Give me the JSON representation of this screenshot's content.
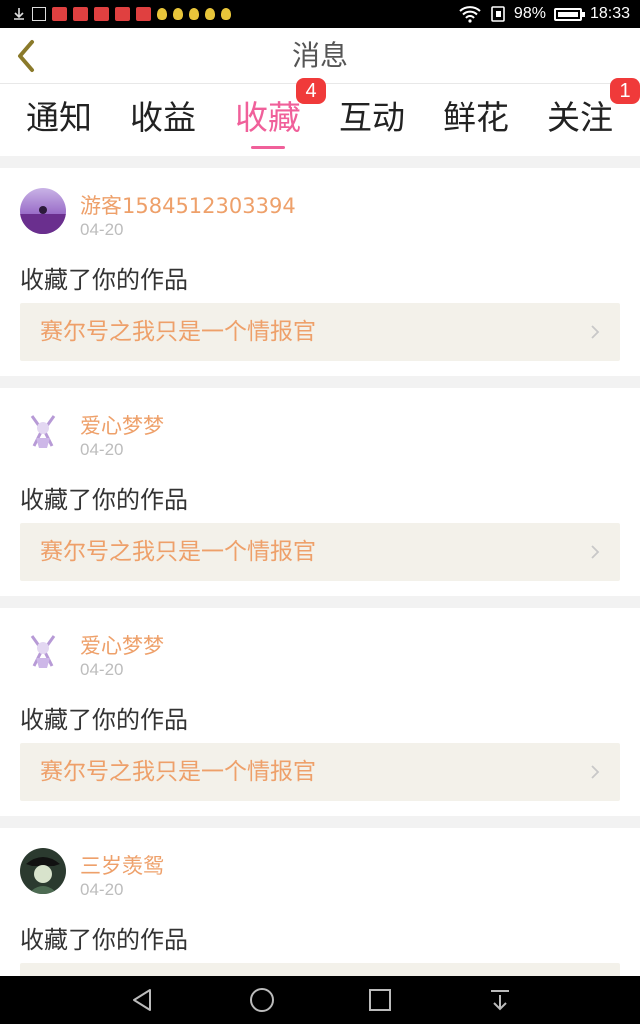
{
  "status_bar": {
    "battery": "98%",
    "time": "18:33"
  },
  "header": {
    "title": "消息"
  },
  "tabs": [
    {
      "label": "通知",
      "badge": ""
    },
    {
      "label": "收益",
      "badge": ""
    },
    {
      "label": "收藏",
      "badge": "4",
      "active": true
    },
    {
      "label": "互动",
      "badge": ""
    },
    {
      "label": "鲜花",
      "badge": ""
    },
    {
      "label": "关注",
      "badge": "1"
    }
  ],
  "messages": [
    {
      "user": "游客1584512303394",
      "date": "04-20",
      "action": "收藏了你的作品",
      "work": "赛尔号之我只是一个情报官"
    },
    {
      "user": "爱心梦梦",
      "date": "04-20",
      "action": "收藏了你的作品",
      "work": "赛尔号之我只是一个情报官"
    },
    {
      "user": "爱心梦梦",
      "date": "04-20",
      "action": "收藏了你的作品",
      "work": "赛尔号之我只是一个情报官"
    },
    {
      "user": "三岁羡鸳",
      "date": "04-20",
      "action": "收藏了你的作品",
      "work": ""
    }
  ],
  "colors": {
    "accent_pink": "#f0609a",
    "name_orange": "#eea06a",
    "badge_red": "#f03a3a",
    "work_bg": "#f3f1ea"
  }
}
